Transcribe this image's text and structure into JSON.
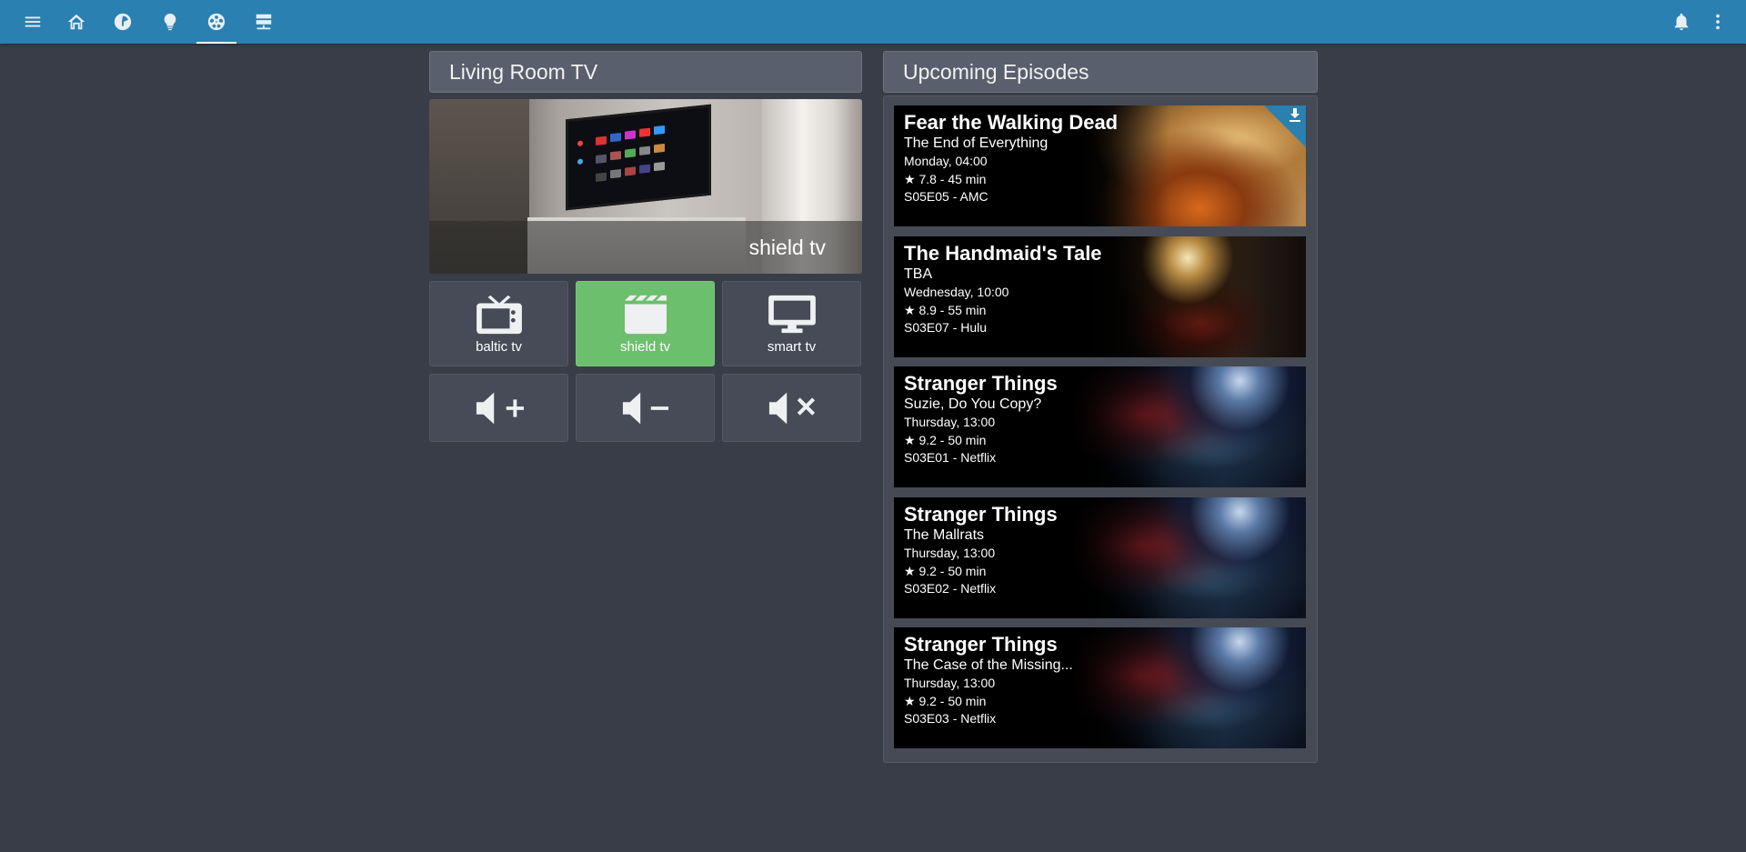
{
  "topbar": {
    "icons": [
      "menu-icon",
      "home-icon",
      "hass-icon",
      "lightbulb-icon",
      "media-reel-icon",
      "server-icon"
    ],
    "active_index": 4,
    "right_icons": [
      "bell-icon",
      "more-vertical-icon"
    ]
  },
  "living_room": {
    "title": "Living Room TV",
    "current_source": "shield tv",
    "sources": [
      {
        "label": "baltic tv",
        "icon": "television-classic-icon",
        "active": false
      },
      {
        "label": "shield tv",
        "icon": "clapperboard-icon",
        "active": true
      },
      {
        "label": "smart tv",
        "icon": "monitor-icon",
        "active": false
      }
    ],
    "volume_buttons": [
      "volume-plus-icon",
      "volume-minus-icon",
      "volume-mute-icon"
    ]
  },
  "upcoming": {
    "title": "Upcoming Episodes",
    "episodes": [
      {
        "title": "Fear the Walking Dead",
        "episode": "The End of Everything",
        "airs": "Monday, 04:00",
        "rating": "★ 7.8 - 45 min",
        "number": "S05E05 - AMC",
        "downloading": true
      },
      {
        "title": "The Handmaid's Tale",
        "episode": "TBA",
        "airs": "Wednesday, 10:00",
        "rating": "★ 8.9 - 55 min",
        "number": "S03E07 - Hulu",
        "downloading": false
      },
      {
        "title": "Stranger Things",
        "episode": "Suzie, Do You Copy?",
        "airs": "Thursday, 13:00",
        "rating": "★ 9.2 - 50 min",
        "number": "S03E01 - Netflix",
        "downloading": false
      },
      {
        "title": "Stranger Things",
        "episode": "The Mallrats",
        "airs": "Thursday, 13:00",
        "rating": "★ 9.2 - 50 min",
        "number": "S03E02 - Netflix",
        "downloading": false
      },
      {
        "title": "Stranger Things",
        "episode": "The Case of the Missing...",
        "airs": "Thursday, 13:00",
        "rating": "★ 9.2 - 50 min",
        "number": "S03E03 - Netflix",
        "downloading": false
      }
    ]
  },
  "colors": {
    "toolbar": "#2a80b0",
    "background": "#393d48",
    "active_button": "#6cbf6c"
  }
}
